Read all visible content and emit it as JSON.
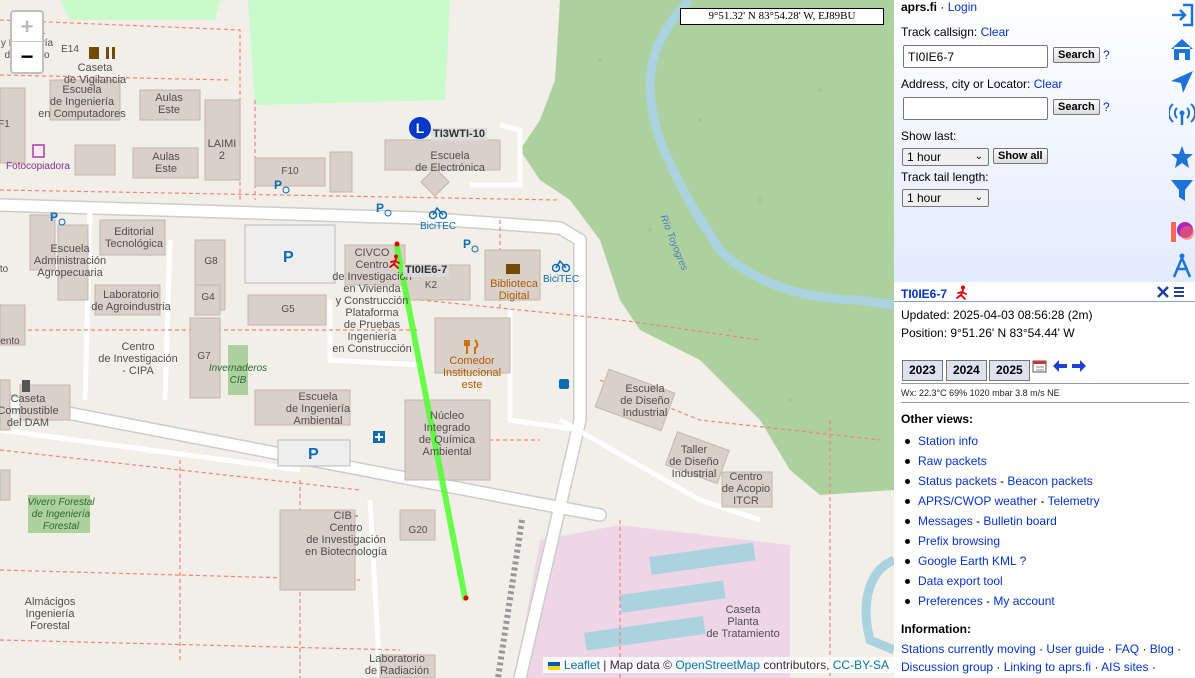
{
  "map": {
    "zoom_in": "+",
    "zoom_out": "−",
    "coord_readout": "9°51.32' N 83°54.28' W, EJ89BU",
    "attribution": {
      "leaflet": "Leaflet",
      "map_data": "| Map data ©",
      "osm": "OpenStreetMap",
      "contributors": "contributors,",
      "license": "CC-BY-SA"
    },
    "station_marker_letter": "L",
    "stations": [
      {
        "call": "TI3WTI-10"
      },
      {
        "call": "TI0IE6-7"
      }
    ],
    "labels": {
      "escuela_y": "Escuela\ny Ingeniería\nde Diseño",
      "e14": "E14",
      "caseta_vigilancia": "Caseta\nde Vigilancia",
      "ing_comp": "Escuela\nde Ingeniería\nen Computadores",
      "aulas_este1": "Aulas\nEste",
      "laimi": "LAIMI\n2",
      "aulas_este2": "Aulas\nEste",
      "f10": "F10",
      "electronica": "Escuela\nde Electrónica",
      "fotocopiadora": "Fotocopiadora",
      "f1": "F1",
      "bicitec1": "BiciTEC",
      "bicitec2": "BiciTEC",
      "editorial": "Editorial\nTecnológica",
      "admin": "Escuela\nAdministración\nAgropecuaria",
      "g8": "G8",
      "g4": "G4",
      "g5": "G5",
      "g7": "G7",
      "lab_agro": "Laboratorio\nde Agroindustria",
      "cipa": "Centro\nde Investigación\n- CIPA",
      "invernaderos": "Invernaderos\nCIB",
      "civco": "CIVCO\nCentro\nde Investigación\nen Vivienda\ny Construcción\nPlataforma\nde Pruebas\nIngeniería\nen Construcción",
      "k2": "K2",
      "biblioteca": "Biblioteca\nDigital",
      "comedor": "Comedor\nInstitucional\neste",
      "caseta_dam": "Caseta\nCombustible\ndel DAM",
      "ing_ambiental": "Escuela\nde Ingeniería\nAmbiental",
      "nucleo": "Núcleo\nIntegrado\nde Química\nAmbiental",
      "diseno_ind": "Escuela\nde Diseño\nIndustrial",
      "taller": "Taller\nde Diseño\nIndustrial",
      "itcr": "Centro\nde Acopio\nITCR",
      "vivero": "Vivero Forestal\nde Ingeniería\nForestal",
      "cib": "CIB -\nCentro\nde Investigación\nen Biotecnología",
      "g20": "G20",
      "almacigos": "Almácigos\nIngeniería\nForestal",
      "planta": "Caseta\nPlanta\nde Tratamiento",
      "lab_rad": "Laboratorio\nde Radiación",
      "rio": "Río Toyogres",
      "ento1": "ento",
      "ento2": "to",
      "ento3": "ento"
    }
  },
  "sidebar": {
    "site": "aprs.fi",
    "dot": "·",
    "login": "Login",
    "track_label": "Track callsign:",
    "clear1": "Clear",
    "callsign_value": "TI0IE6-7",
    "search1": "Search",
    "help1": "?",
    "address_label": "Address, city or Locator:",
    "clear2": "Clear",
    "address_value": "",
    "search2": "Search",
    "help2": "?",
    "show_last_label": "Show last:",
    "show_last_value": "1 hour",
    "show_all": "Show all",
    "tail_label": "Track tail length:",
    "tail_value": "1 hour"
  },
  "station": {
    "callsign": "TI0IE6-7",
    "updated": "Updated: 2025-04-03 08:56:28 (2m)",
    "position": "Position: 9°51.26' N 83°54.44' W",
    "years": [
      "2023",
      "2024",
      "2025"
    ],
    "wx": "Wx: 22.3°C 69% 1020 mbar 3.8 m/s NE"
  },
  "other_views": {
    "heading": "Other views:",
    "items": [
      {
        "a": "Station info",
        "sep": "",
        "b": ""
      },
      {
        "a": "Raw packets",
        "sep": "",
        "b": ""
      },
      {
        "a": "Status packets",
        "sep": " - ",
        "b": "Beacon packets"
      },
      {
        "a": "APRS/CWOP weather",
        "sep": " - ",
        "b": "Telemetry"
      },
      {
        "a": "Messages",
        "sep": " - ",
        "b": "Bulletin board"
      },
      {
        "a": "Prefix browsing",
        "sep": "",
        "b": ""
      },
      {
        "a": "Google Earth KML",
        "sep": " ",
        "b": "?"
      },
      {
        "a": "Data export tool",
        "sep": "",
        "b": ""
      },
      {
        "a": "Preferences",
        "sep": " - ",
        "b": "My account"
      }
    ]
  },
  "information": {
    "heading": "Information:",
    "l1": "Stations currently moving",
    "l2": "User guide",
    "l3": "FAQ",
    "l4": "Blog",
    "l5": "Discussion group",
    "l6": "Linking to aprs.fi",
    "l7": "AIS sites",
    "sep": " · "
  },
  "colors": {
    "map_bg": "#f2efe9",
    "park": "#c8facc",
    "forest": "#add19e",
    "building": "#d9d0c9",
    "road": "#ffffff",
    "path_red": "#fa8072",
    "river": "#aad3df",
    "track": "#50ff30",
    "link": "#0033cc",
    "rail_icon": "#1e73d8"
  },
  "icons": [
    "zoom-in-icon",
    "zoom-out-icon",
    "sidebar-collapse-icon",
    "home-icon",
    "navigate-icon",
    "radio-tower-icon",
    "star-icon",
    "filter-icon",
    "patreon-icon",
    "compass-icon",
    "close-icon",
    "menu-icon",
    "calendar-icon",
    "arrow-left-icon",
    "arrow-right-icon",
    "runner-icon"
  ]
}
